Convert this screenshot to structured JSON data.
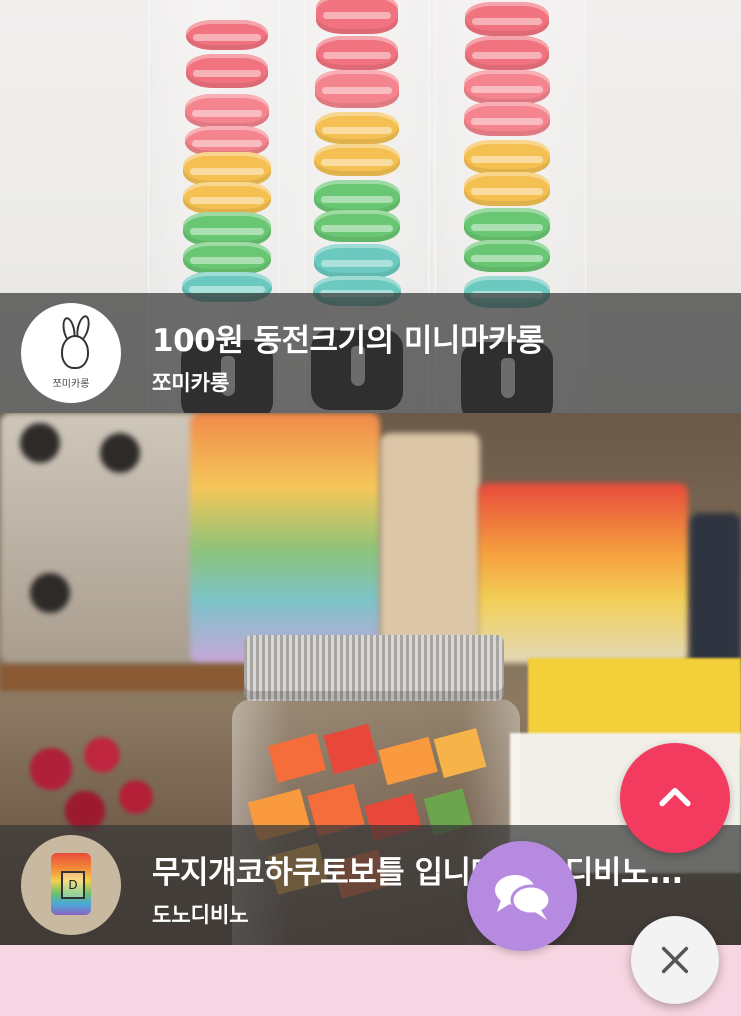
{
  "feed": {
    "items": [
      {
        "title": "100원 동전크기의 미니마카롱",
        "shop": "쪼미카롱",
        "avatar_text": "쪼미카롱",
        "image_icon": "macaron-sticks-photo"
      },
      {
        "title": "무지개코하쿠토보틀 입니다 도노디비노...",
        "shop": "도노디비노",
        "avatar_text": "D",
        "image_icon": "candy-jar-photo"
      }
    ]
  },
  "floating": {
    "scroll_top_icon": "chevron-up-icon",
    "chat_icon": "chat-bubbles-icon",
    "close_icon": "close-icon",
    "colors": {
      "scroll_top": "#f23b5f",
      "chat": "#b68ae0",
      "close": "#f3f3f3"
    }
  }
}
